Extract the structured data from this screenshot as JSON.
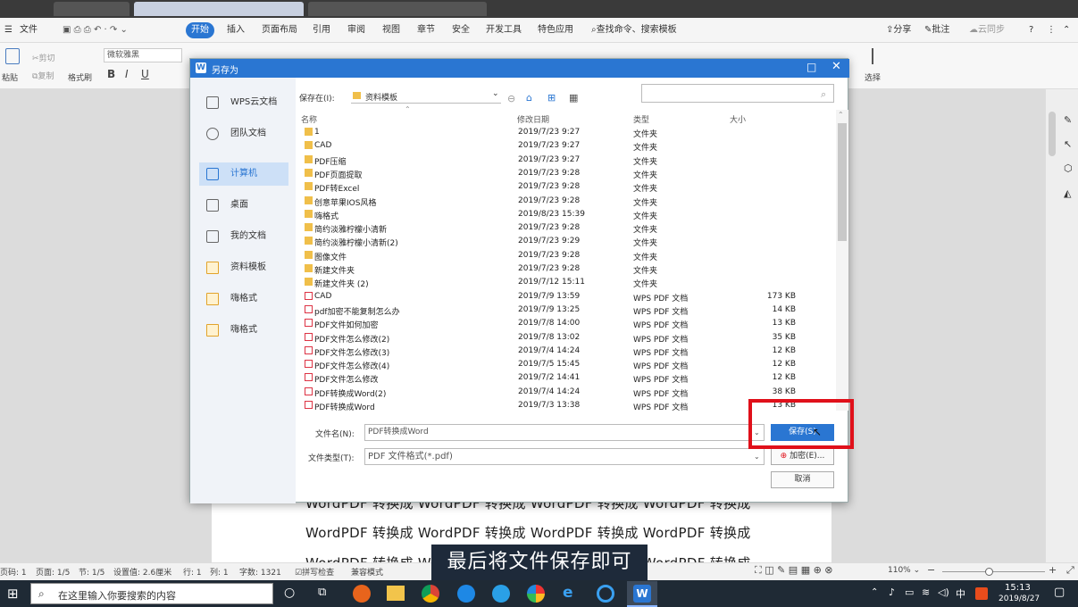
{
  "app": {
    "menu": [
      "文件",
      "开始",
      "插入",
      "页面布局",
      "引用",
      "审阅",
      "视图",
      "章节",
      "安全",
      "开发工具",
      "特色应用"
    ],
    "search_cmd": "查找命令、搜索模板",
    "share": "分享",
    "annotate": "批注",
    "cloud_sync": "云同步",
    "help": "?",
    "ribbon": {
      "paste": "粘贴",
      "cut": "剪切",
      "copy": "复制",
      "format_painter": "格式刷",
      "font": "微软雅黑",
      "bold": "B",
      "italic": "I",
      "underline": "U",
      "select": "选择"
    }
  },
  "dialog": {
    "title": "另存为",
    "save_in_label": "保存在(I):",
    "save_in_value": "资料模板",
    "sidebar": [
      "WPS云文档",
      "团队文档",
      "计算机",
      "桌面",
      "我的文档",
      "资料模板",
      "嗨格式",
      "嗨格式"
    ],
    "columns": [
      "名称",
      "修改日期",
      "类型",
      "大小"
    ],
    "files": [
      {
        "name": "1",
        "date": "2019/7/23 9:27",
        "type": "文件夹",
        "size": "",
        "kind": "folder"
      },
      {
        "name": "CAD",
        "date": "2019/7/23 9:27",
        "type": "文件夹",
        "size": "",
        "kind": "folder"
      },
      {
        "name": "PDF压缩",
        "date": "2019/7/23 9:27",
        "type": "文件夹",
        "size": "",
        "kind": "folder"
      },
      {
        "name": "PDF页面提取",
        "date": "2019/7/23 9:28",
        "type": "文件夹",
        "size": "",
        "kind": "folder"
      },
      {
        "name": "PDF转Excel",
        "date": "2019/7/23 9:28",
        "type": "文件夹",
        "size": "",
        "kind": "folder"
      },
      {
        "name": "创意苹果IOS风格",
        "date": "2019/7/23 9:28",
        "type": "文件夹",
        "size": "",
        "kind": "folder"
      },
      {
        "name": "嗨格式",
        "date": "2019/8/23 15:39",
        "type": "文件夹",
        "size": "",
        "kind": "folder"
      },
      {
        "name": "简约淡雅柠檬小清新",
        "date": "2019/7/23 9:28",
        "type": "文件夹",
        "size": "",
        "kind": "folder"
      },
      {
        "name": "简约淡雅柠檬小清新(2)",
        "date": "2019/7/23 9:29",
        "type": "文件夹",
        "size": "",
        "kind": "folder"
      },
      {
        "name": "图像文件",
        "date": "2019/7/23 9:28",
        "type": "文件夹",
        "size": "",
        "kind": "folder"
      },
      {
        "name": "新建文件夹",
        "date": "2019/7/23 9:28",
        "type": "文件夹",
        "size": "",
        "kind": "folder"
      },
      {
        "name": "新建文件夹 (2)",
        "date": "2019/7/12 15:11",
        "type": "文件夹",
        "size": "",
        "kind": "folder"
      },
      {
        "name": "CAD",
        "date": "2019/7/9 13:59",
        "type": "WPS PDF 文档",
        "size": "173 KB",
        "kind": "pdf"
      },
      {
        "name": "pdf加密不能复制怎么办",
        "date": "2019/7/9 13:25",
        "type": "WPS PDF 文档",
        "size": "14 KB",
        "kind": "pdf"
      },
      {
        "name": "PDF文件如何加密",
        "date": "2019/7/8 14:00",
        "type": "WPS PDF 文档",
        "size": "13 KB",
        "kind": "pdf"
      },
      {
        "name": "PDF文件怎么修改(2)",
        "date": "2019/7/8 13:02",
        "type": "WPS PDF 文档",
        "size": "35 KB",
        "kind": "pdf"
      },
      {
        "name": "PDF文件怎么修改(3)",
        "date": "2019/7/4 14:24",
        "type": "WPS PDF 文档",
        "size": "12 KB",
        "kind": "pdf"
      },
      {
        "name": "PDF文件怎么修改(4)",
        "date": "2019/7/5 15:45",
        "type": "WPS PDF 文档",
        "size": "12 KB",
        "kind": "pdf"
      },
      {
        "name": "PDF文件怎么修改",
        "date": "2019/7/2 14:41",
        "type": "WPS PDF 文档",
        "size": "12 KB",
        "kind": "pdf"
      },
      {
        "name": "PDF转换成Word(2)",
        "date": "2019/7/4 14:24",
        "type": "WPS PDF 文档",
        "size": "38 KB",
        "kind": "pdf"
      },
      {
        "name": "PDF转换成Word",
        "date": "2019/7/3 13:38",
        "type": "WPS PDF 文档",
        "size": "13 KB",
        "kind": "pdf"
      }
    ],
    "filename_label": "文件名(N):",
    "filename_value": "PDF转换成Word",
    "filetype_label": "文件类型(T):",
    "filetype_value": "PDF 文件格式(*.pdf)",
    "save_button": "保存(S)",
    "encrypt_button": "加密(E)...",
    "cancel_button": "取消"
  },
  "document": {
    "line": "WordPDF 转换成 WordPDF 转换成 WordPDF 转换成 WordPDF 转换成"
  },
  "subtitle": "最后将文件保存即可",
  "status": {
    "page": "页码: 1",
    "pages": "页面: 1/5",
    "section": "节: 1/5",
    "setting": "设置值: 2.6厘米",
    "row": "行: 1",
    "col": "列: 1",
    "words": "字数: 1321",
    "spell": "拼写检查",
    "compat": "兼容模式",
    "zoom": "110%"
  },
  "taskbar": {
    "search_placeholder": "在这里输入你要搜索的内容",
    "time": "15:13",
    "date": "2019/8/27",
    "ime": "中"
  },
  "colors": {
    "accent": "#2a76d2",
    "highlight": "#e0101a"
  }
}
